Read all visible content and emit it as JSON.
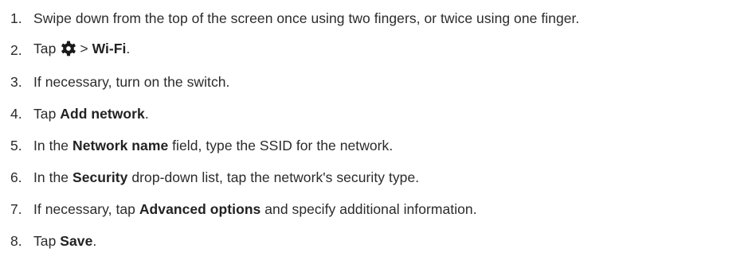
{
  "steps": [
    {
      "number": "1.",
      "parts": [
        {
          "text": "Swipe down from the top of the screen once using two fingers, or twice using one finger.",
          "bold": false
        }
      ]
    },
    {
      "number": "2.",
      "parts": [
        {
          "text": "Tap",
          "bold": false
        },
        {
          "icon": "gear-icon"
        },
        {
          "text": "> ",
          "bold": false
        },
        {
          "text": "Wi-Fi",
          "bold": true
        },
        {
          "text": ".",
          "bold": false
        }
      ]
    },
    {
      "number": "3.",
      "parts": [
        {
          "text": "If necessary, turn on the switch.",
          "bold": false
        }
      ]
    },
    {
      "number": "4.",
      "parts": [
        {
          "text": "Tap ",
          "bold": false
        },
        {
          "text": "Add network",
          "bold": true
        },
        {
          "text": ".",
          "bold": false
        }
      ]
    },
    {
      "number": "5.",
      "parts": [
        {
          "text": "In the ",
          "bold": false
        },
        {
          "text": "Network name",
          "bold": true
        },
        {
          "text": " field, type the SSID for the network.",
          "bold": false
        }
      ]
    },
    {
      "number": "6.",
      "parts": [
        {
          "text": "In the ",
          "bold": false
        },
        {
          "text": "Security",
          "bold": true
        },
        {
          "text": " drop-down list, tap the network's security type.",
          "bold": false
        }
      ]
    },
    {
      "number": "7.",
      "parts": [
        {
          "text": "If necessary, tap ",
          "bold": false
        },
        {
          "text": "Advanced options",
          "bold": true
        },
        {
          "text": " and specify additional information.",
          "bold": false
        }
      ]
    },
    {
      "number": "8.",
      "parts": [
        {
          "text": "Tap ",
          "bold": false
        },
        {
          "text": "Save",
          "bold": true
        },
        {
          "text": ".",
          "bold": false
        }
      ]
    }
  ],
  "colors": {
    "text": "#2b2b2b",
    "bold": "#222222",
    "icon": "#1a1a1a"
  }
}
